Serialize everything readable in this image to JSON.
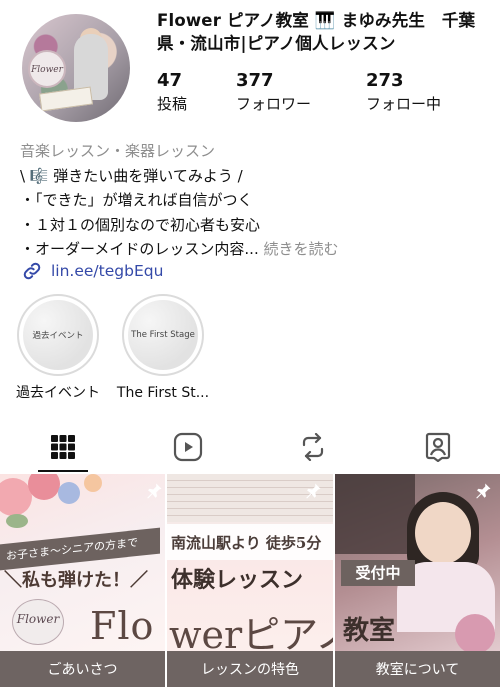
{
  "profile": {
    "name": "Flower ピアノ教室 🎹 まゆみ先生　千葉県・流山市|ピアノ個人レッスン",
    "avatar_label": "Flower",
    "stats": [
      {
        "value": "47",
        "label": "投稿"
      },
      {
        "value": "377",
        "label": "フォロワー"
      },
      {
        "value": "273",
        "label": "フォロー中"
      }
    ]
  },
  "bio": {
    "category": "音楽レッスン・楽器レッスン",
    "lines": [
      "\\ 🎼 弾きたい曲を弾いてみよう /",
      "・「できた」が増えれば自信がつく",
      "・１対１の個別なので初心者も安心",
      "・オーダーメイドのレッスン内容..."
    ],
    "more_label": "続きを読む",
    "link": "lin.ee/tegbEqu"
  },
  "highlights": [
    {
      "label": "過去イベント",
      "cover_text": "過去イベント"
    },
    {
      "label": "The First St...",
      "cover_text": "The First Stage"
    }
  ],
  "tabs": [
    {
      "name": "grid",
      "icon": "grid-icon"
    },
    {
      "name": "reels",
      "icon": "reels-icon"
    },
    {
      "name": "reposts",
      "icon": "repost-icon"
    },
    {
      "name": "tagged",
      "icon": "tagged-user-icon"
    }
  ],
  "posts": [
    {
      "caption": "ごあいさつ",
      "banner": "お子さま〜シニアの方まで",
      "headline": "＼私も弾けた！／",
      "logo": "Flower",
      "big": "Flo"
    },
    {
      "caption": "レッスンの特色",
      "line1": "南流山駅より 徒歩5分",
      "line2": "体験レッスン",
      "big": "werピアノ"
    },
    {
      "caption": "教室について",
      "tag": "受付中",
      "big": "教室"
    }
  ],
  "colors": {
    "link": "#3449a8",
    "muted": "#8e8e8e",
    "caption_bg": "#6e6462"
  }
}
